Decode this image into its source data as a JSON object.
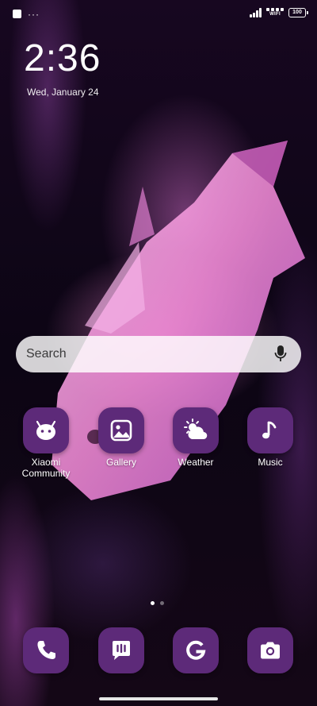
{
  "status_bar": {
    "battery": "100",
    "wifi_label": "WIFI",
    "notification_dots": "···"
  },
  "lockscreen": {
    "time": "2:36",
    "date": "Wed, January 24"
  },
  "search": {
    "label": "Search"
  },
  "apps": [
    {
      "label": "Xiaomi Community",
      "icon": "xiaomi-community-icon"
    },
    {
      "label": "Gallery",
      "icon": "gallery-icon"
    },
    {
      "label": "Weather",
      "icon": "weather-icon"
    },
    {
      "label": "Music",
      "icon": "music-icon"
    }
  ],
  "dock": [
    {
      "icon": "phone-icon"
    },
    {
      "icon": "messages-icon"
    },
    {
      "icon": "google-icon"
    },
    {
      "icon": "camera-icon"
    }
  ],
  "page_indicator": {
    "pages": 2,
    "current": 1
  },
  "colors": {
    "icon_bg": "#5d2a79",
    "search_bg": "#ffffff"
  }
}
